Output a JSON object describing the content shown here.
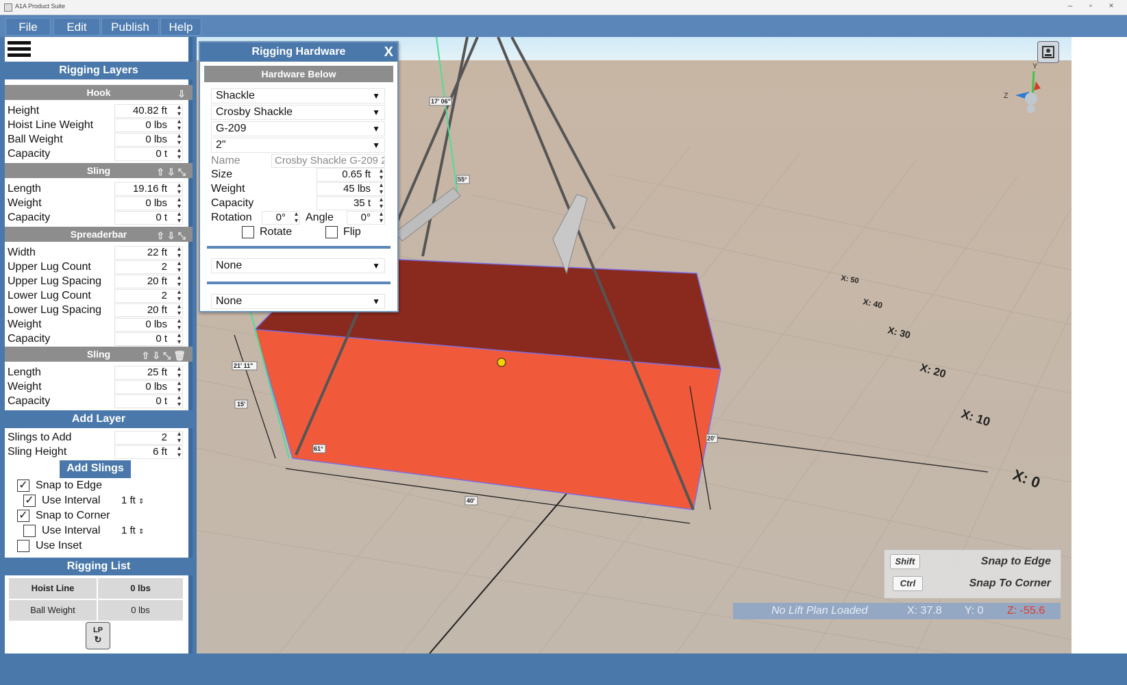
{
  "window": {
    "title": "A1A Product Suite"
  },
  "menu": [
    "File",
    "Edit",
    "Publish",
    "Help"
  ],
  "left_panel": {
    "title": "Rigging Layers",
    "hook": {
      "header": "Hook",
      "fields": [
        {
          "label": "Height",
          "value": "40.82 ft"
        },
        {
          "label": "Hoist Line Weight",
          "value": "0 lbs"
        },
        {
          "label": "Ball Weight",
          "value": "0 lbs"
        },
        {
          "label": "Capacity",
          "value": "0 t"
        }
      ]
    },
    "sling1": {
      "header": "Sling",
      "fields": [
        {
          "label": "Length",
          "value": "19.16 ft"
        },
        {
          "label": "Weight",
          "value": "0 lbs"
        },
        {
          "label": "Capacity",
          "value": "0 t"
        }
      ]
    },
    "spreaderbar": {
      "header": "Spreaderbar",
      "fields": [
        {
          "label": "Width",
          "value": "22 ft"
        },
        {
          "label": "Upper Lug Count",
          "value": "2"
        },
        {
          "label": "Upper Lug Spacing",
          "value": "20 ft"
        },
        {
          "label": "Lower Lug Count",
          "value": "2"
        },
        {
          "label": "Lower Lug Spacing",
          "value": "20 ft"
        },
        {
          "label": "Weight",
          "value": "0 lbs"
        },
        {
          "label": "Capacity",
          "value": "0 t"
        }
      ]
    },
    "sling2": {
      "header": "Sling",
      "fields": [
        {
          "label": "Length",
          "value": "25 ft"
        },
        {
          "label": "Weight",
          "value": "0 lbs"
        },
        {
          "label": "Capacity",
          "value": "0 t"
        }
      ]
    },
    "add_layer": {
      "title": "Add Layer",
      "fields": [
        {
          "label": "Slings to Add",
          "value": "2"
        },
        {
          "label": "Sling Height",
          "value": "6 ft"
        }
      ],
      "button": "Add Slings"
    },
    "options": {
      "snap_edge": {
        "label": "Snap to Edge",
        "checked": true
      },
      "use_interval_1": {
        "label": "Use Interval",
        "checked": true,
        "value": "1 ft"
      },
      "snap_corner": {
        "label": "Snap to Corner",
        "checked": true
      },
      "use_interval_2": {
        "label": "Use Interval",
        "checked": false,
        "value": "1 ft"
      },
      "use_inset": {
        "label": "Use Inset",
        "checked": false
      }
    },
    "rigging_list": {
      "title": "Rigging List",
      "rows": [
        [
          "Hoist Line",
          "0 lbs"
        ],
        [
          "Ball Weight",
          "0 lbs"
        ]
      ]
    },
    "lp_button": "LP"
  },
  "dialog": {
    "title": "Rigging Hardware",
    "close": "X",
    "subheader": "Hardware Below",
    "selects": [
      "Shackle",
      "Crosby Shackle",
      "G-209",
      "2\""
    ],
    "name": {
      "label": "Name",
      "value": "Crosby Shackle G-209 2"
    },
    "size": {
      "label": "Size",
      "value": "0.65 ft"
    },
    "weight": {
      "label": "Weight",
      "value": "45 lbs"
    },
    "capacity": {
      "label": "Capacity",
      "value": "35 t"
    },
    "rotation": {
      "label": "Rotation",
      "value": "0°"
    },
    "angle": {
      "label": "Angle",
      "value": "0°"
    },
    "rotate": {
      "label": "Rotate",
      "checked": false
    },
    "flip": {
      "label": "Flip",
      "checked": false
    },
    "select_below_1": "None",
    "select_below_2": "None"
  },
  "scene": {
    "axis_labels": [
      "X: 0",
      "X: 10",
      "X: 20",
      "X: 30",
      "X: 40",
      "X: 50"
    ],
    "gizmo": {
      "y": "Y",
      "z": "Z"
    },
    "dims": [
      "17' 06\"",
      "55°",
      "21' 11\"",
      "15'",
      "61°",
      "40'",
      "20'"
    ]
  },
  "hints": [
    {
      "key": "Shift",
      "label": "Snap to Edge"
    },
    {
      "key": "Ctrl",
      "label": "Snap To Corner"
    }
  ],
  "status": {
    "plan": "No Lift Plan Loaded",
    "x": "X: 37.8",
    "y": "Y: 0",
    "z": "Z: -55.6"
  },
  "colors": {
    "accent": "#4a78ab",
    "box_front": "#f05a3a",
    "box_top": "#8a2a1f",
    "ground": "#c9b9a8",
    "sky": "#cde8f5"
  }
}
